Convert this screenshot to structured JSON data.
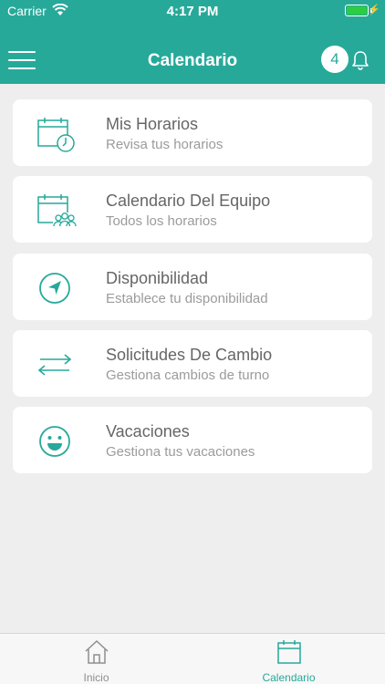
{
  "status_bar": {
    "carrier": "Carrier",
    "time": "4:17 PM",
    "battery_level": 1.0
  },
  "header": {
    "title": "Calendario",
    "notification_count": "4"
  },
  "menu": [
    {
      "label": "Mis Horarios",
      "subtitle": "Revisa tus horarios",
      "icon": "calendar-clock-icon"
    },
    {
      "label": "Calendario Del Equipo",
      "subtitle": "Todos los horarios",
      "icon": "calendar-team-icon"
    },
    {
      "label": "Disponibilidad",
      "subtitle": "Establece tu disponibilidad",
      "icon": "navigation-arrow-icon"
    },
    {
      "label": "Solicitudes De Cambio",
      "subtitle": "Gestiona cambios de turno",
      "icon": "swap-arrows-icon"
    },
    {
      "label": "Vacaciones",
      "subtitle": "Gestiona tus vacaciones",
      "icon": "smiley-icon"
    }
  ],
  "tabs": [
    {
      "label": "Inicio",
      "icon": "home-icon",
      "active": false
    },
    {
      "label": "Calendario",
      "icon": "calendar-icon",
      "active": true
    }
  ],
  "colors": {
    "accent": "#27a99a",
    "background": "#eeeeee",
    "card": "#ffffff",
    "battery": "#2ecc40"
  }
}
